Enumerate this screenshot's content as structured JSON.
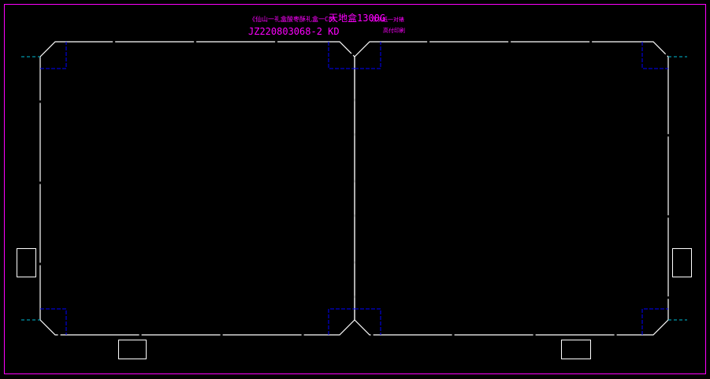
{
  "drawing": {
    "header_line1_part1": "《仙山一礼盒酸枣酥礼盒一C8》",
    "header_line1_part2": "天地盒1300G",
    "header_line1_part3": "双灰纸一对裱",
    "header_line2": "JZ220803068-2 KD",
    "header_line2_note": "高付印刷"
  },
  "colors": {
    "frame": "#ff00ff",
    "cut_line": "#ffffff",
    "fold_mark": "#0000ff",
    "guide": "#00bcd4",
    "text": "#ff00ff"
  }
}
